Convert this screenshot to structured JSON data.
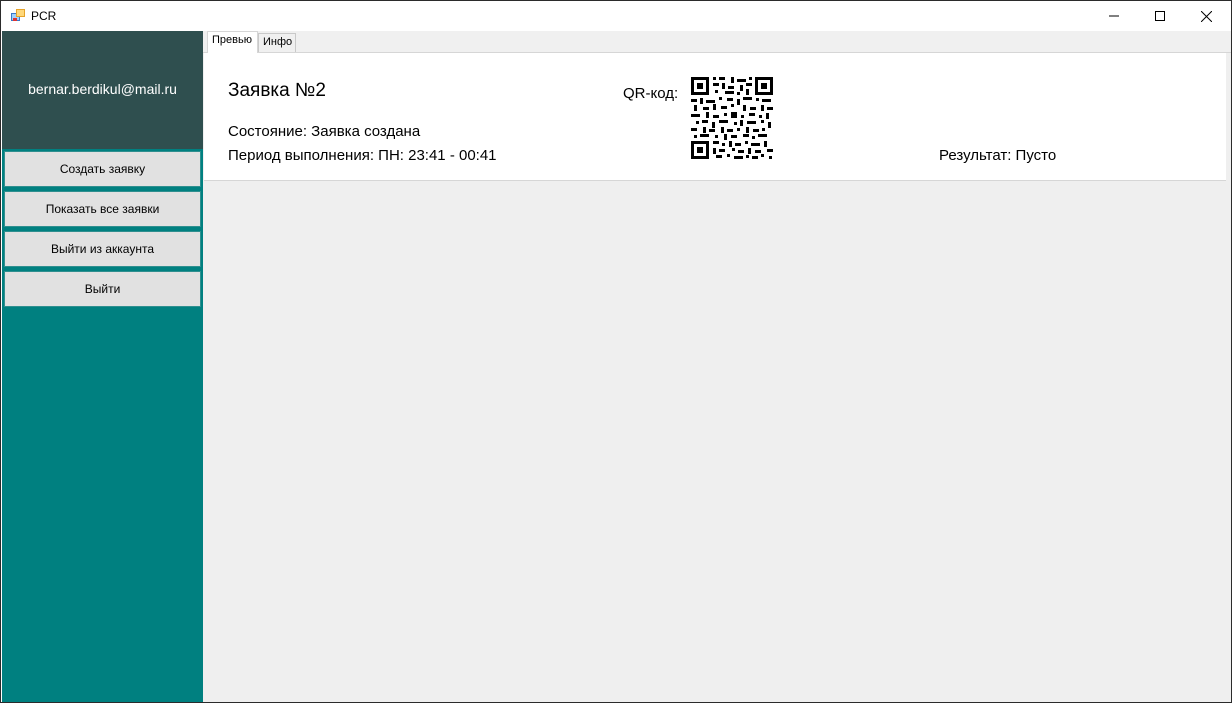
{
  "window": {
    "title": "PCR",
    "icon": "app-window-icon",
    "controls": [
      "minimize-icon",
      "maximize-icon",
      "close-icon"
    ]
  },
  "sidebar": {
    "user_email": "bernar.berdikul@mail.ru",
    "buttons": [
      {
        "label": "Создать заявку"
      },
      {
        "label": "Показать все заявки"
      },
      {
        "label": "Выйти из аккаунта"
      },
      {
        "label": "Выйти"
      }
    ]
  },
  "tabs": [
    {
      "label": "Превью",
      "active": true
    },
    {
      "label": "Инфо",
      "active": false
    }
  ],
  "preview": {
    "title": "Заявка №2",
    "state": "Состояние: Заявка создана",
    "period": "Период выполнения: ПН: 23:41 - 00:41",
    "qr_label": "QR-код:",
    "result": "Результат: Пусто"
  },
  "colors": {
    "sidebar_bg": "#008080",
    "user_panel_bg": "#2f4f4f",
    "content_bg": "#efefef",
    "button_bg": "#e1e1e1"
  }
}
